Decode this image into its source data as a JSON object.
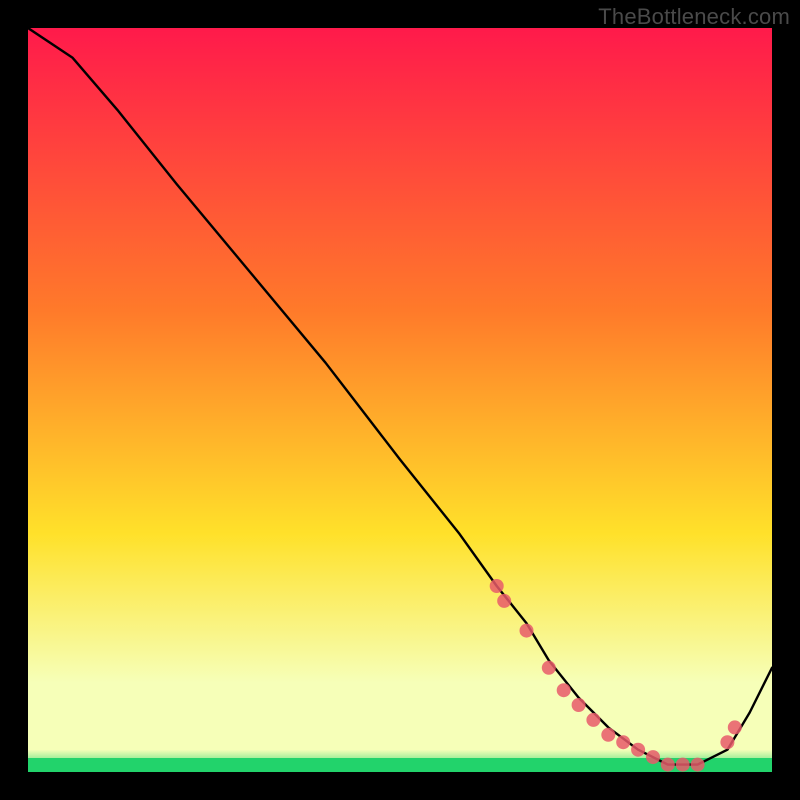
{
  "watermark": "TheBottleneck.com",
  "chart_data": {
    "type": "line",
    "title": "",
    "xlabel": "",
    "ylabel": "",
    "xlim": [
      0,
      100
    ],
    "ylim": [
      0,
      100
    ],
    "grid": false,
    "legend": false,
    "series": [
      {
        "name": "curve",
        "x": [
          0,
          6,
          12,
          20,
          30,
          40,
          50,
          58,
          63,
          67,
          70,
          74,
          78,
          82,
          86,
          90,
          94,
          97,
          100
        ],
        "y": [
          100,
          96,
          89,
          79,
          67,
          55,
          42,
          32,
          25,
          20,
          15,
          10,
          6,
          3,
          1,
          1,
          3,
          8,
          14
        ]
      }
    ],
    "highlight_points": {
      "name": "dots",
      "color": "#e85a6a",
      "x": [
        63,
        64,
        67,
        70,
        72,
        74,
        76,
        78,
        80,
        82,
        84,
        86,
        88,
        90,
        94,
        95
      ],
      "y": [
        25,
        23,
        19,
        14,
        11,
        9,
        7,
        5,
        4,
        3,
        2,
        1,
        1,
        1,
        4,
        6
      ]
    },
    "background_gradient": {
      "top": "#ff1a4b",
      "mid1": "#ff7a2a",
      "mid2": "#ffe12a",
      "low": "#f6ffb8",
      "bottom": "#22d36b"
    }
  }
}
